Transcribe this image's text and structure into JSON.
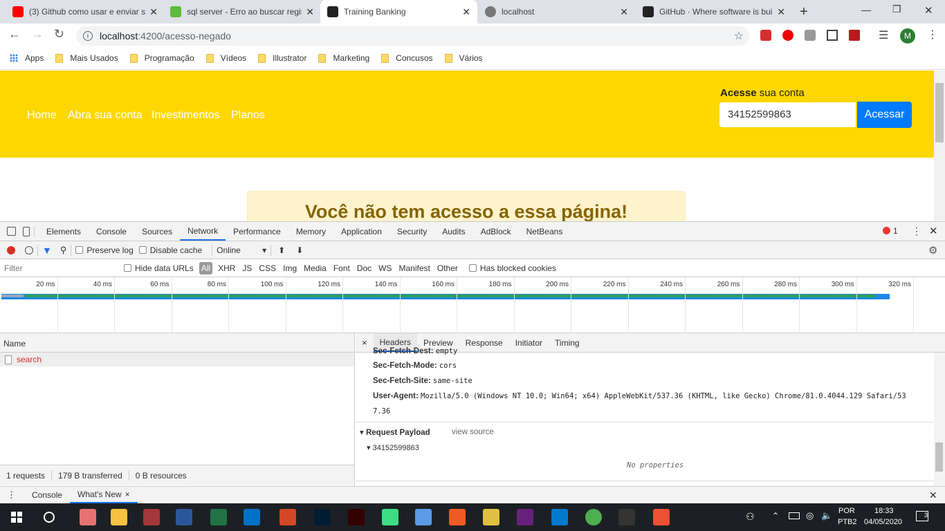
{
  "browser": {
    "tabs": [
      {
        "title": "(3) Github como usar e enviar s",
        "icon": "youtube-icon",
        "color": "#ff0000"
      },
      {
        "title": "sql server - Erro ao buscar regis",
        "icon": "stackoverflow-icon",
        "color": "#5eba3c"
      },
      {
        "title": "Training Banking",
        "icon": "angular-icon",
        "color": "#222222",
        "active": true
      },
      {
        "title": "localhost",
        "icon": "globe-icon",
        "color": "#777777"
      },
      {
        "title": "GitHub · Where software is buil",
        "icon": "github-icon",
        "color": "#222222"
      }
    ],
    "url_host": "localhost",
    "url_rest": ":4200/acesso-negado",
    "profile_initial": "M",
    "bookmarks": [
      "Apps",
      "Mais Usados",
      "Programação",
      "Vídeos",
      "Illustrator",
      "Marketing",
      "Concusos",
      "Vários"
    ]
  },
  "site": {
    "nav": [
      "Home",
      "Abra sua conta",
      "Investimentos",
      "Planos"
    ],
    "login_label_bold": "Acesse",
    "login_label_rest": " sua conta",
    "login_value": "34152599863",
    "login_button": "Acessar",
    "alert": "Você não tem acesso a essa página!",
    "colors": {
      "header": "#fed700",
      "button": "#007bff",
      "alert_bg": "#fff3cd",
      "alert_text": "#856404"
    }
  },
  "devtools": {
    "tabs": [
      "Elements",
      "Console",
      "Sources",
      "Network",
      "Performance",
      "Memory",
      "Application",
      "Security",
      "Audits",
      "AdBlock",
      "NetBeans"
    ],
    "selected_tab": "Network",
    "error_count": "1",
    "preserve_log": "Preserve log",
    "disable_cache": "Disable cache",
    "throttle": "Online",
    "filter_placeholder": "Filter",
    "hide_data_urls": "Hide data URLs",
    "filter_types": [
      "All",
      "XHR",
      "JS",
      "CSS",
      "Img",
      "Media",
      "Font",
      "Doc",
      "WS",
      "Manifest",
      "Other"
    ],
    "blocked_cookies": "Has blocked cookies",
    "timeline_ticks": [
      "20 ms",
      "40 ms",
      "60 ms",
      "80 ms",
      "100 ms",
      "120 ms",
      "140 ms",
      "160 ms",
      "180 ms",
      "200 ms",
      "220 ms",
      "240 ms",
      "260 ms",
      "280 ms",
      "300 ms",
      "320 ms"
    ],
    "name_header": "Name",
    "requests": [
      {
        "name": "search",
        "status": "error"
      }
    ],
    "summary": [
      "1 requests",
      "179 B transferred",
      "0 B resources"
    ],
    "detail_tabs": [
      "Headers",
      "Preview",
      "Response",
      "Initiator",
      "Timing"
    ],
    "headers": [
      {
        "k": "Sec-Fetch-Dest:",
        "v": "empty"
      },
      {
        "k": "Sec-Fetch-Mode:",
        "v": "cors"
      },
      {
        "k": "Sec-Fetch-Site:",
        "v": "same-site"
      },
      {
        "k": "User-Agent:",
        "v": "Mozilla/5.0 (Windows NT 10.0; Win64; x64) AppleWebKit/537.36 (KHTML, like Gecko) Chrome/81.0.4044.129 Safari/53",
        "v2": "7.36"
      }
    ],
    "payload_title": "Request Payload",
    "view_source": "view source",
    "payload_value": "34152599863",
    "no_properties": "No properties",
    "drawer_tabs": [
      "Console",
      "What's New"
    ]
  },
  "taskbar": {
    "lang1": "POR",
    "lang2": "PTB2",
    "time": "18:33",
    "date": "04/05/2020",
    "notifications": "3"
  }
}
